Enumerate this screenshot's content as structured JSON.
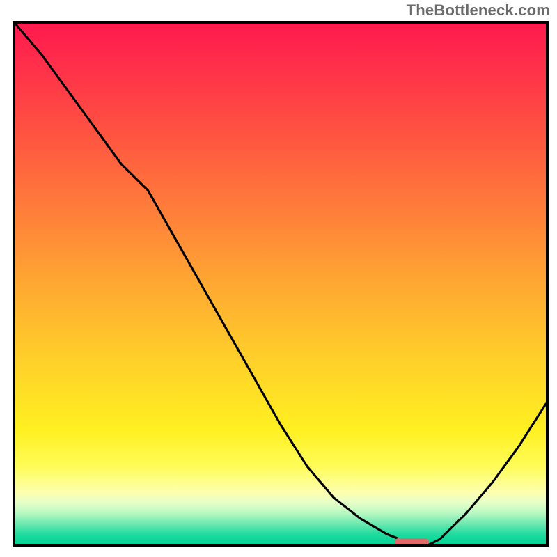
{
  "watermark": "TheBottleneck.com",
  "chart_data": {
    "type": "line",
    "x": [
      0.0,
      0.05,
      0.1,
      0.15,
      0.2,
      0.25,
      0.3,
      0.35,
      0.4,
      0.45,
      0.5,
      0.55,
      0.6,
      0.65,
      0.7,
      0.75,
      0.78,
      0.8,
      0.85,
      0.9,
      0.95,
      1.0
    ],
    "values": [
      100,
      94,
      87,
      80,
      73,
      68,
      59,
      50,
      41,
      32,
      23,
      15,
      9,
      5,
      2,
      0,
      0,
      1,
      6,
      12,
      19,
      27
    ],
    "title": "",
    "xlabel": "",
    "ylabel": "",
    "xlim": [
      0,
      1
    ],
    "ylim": [
      0,
      100
    ],
    "marker": {
      "x_start": 0.715,
      "x_end": 0.78,
      "y": 0
    }
  },
  "colors": {
    "gradient_top": "#ff1a4e",
    "gradient_bottom": "#00d394",
    "curve": "#000000",
    "marker": "#e06a6a",
    "border": "#000000"
  }
}
